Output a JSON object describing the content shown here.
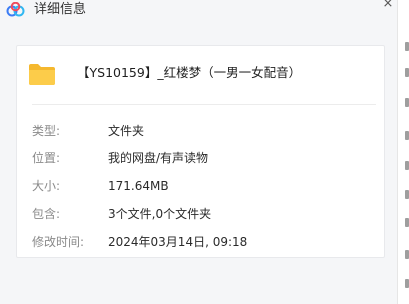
{
  "window": {
    "title": "详细信息",
    "close_glyph": "×"
  },
  "file": {
    "name": "【YS10159】_红楼梦（一男一女配音）",
    "icon": "folder-icon",
    "icon_color": "#f7c641"
  },
  "details": [
    {
      "key": "type",
      "label": "类型:",
      "value": "文件夹"
    },
    {
      "key": "location",
      "label": "位置:",
      "value": "我的网盘/有声读物"
    },
    {
      "key": "size",
      "label": "大小:",
      "value": "171.64MB"
    },
    {
      "key": "contains",
      "label": "包含:",
      "value": "3个文件,0个文件夹"
    },
    {
      "key": "modified",
      "label": "修改时间:",
      "value": "2024年03月14日, 09:18"
    }
  ],
  "colors": {
    "background": "#f5f6f8",
    "card": "#ffffff",
    "label": "#8a8a8a",
    "value": "#2a2a2a"
  }
}
